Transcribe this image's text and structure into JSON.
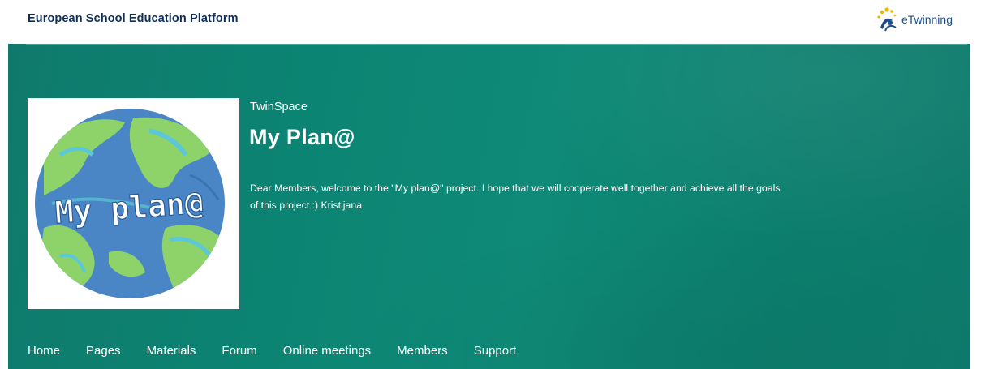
{
  "header": {
    "platform_title": "European School Education Platform",
    "logo_text": "eTwinning"
  },
  "hero": {
    "section_label": "TwinSpace",
    "title": "My Plan@",
    "description": "Dear Members, welcome to the \"My plan@\" project. I hope that we will cooperate well together and achieve all the goals of this project :) Kristijana",
    "image_text": "My plan@"
  },
  "nav": {
    "items": [
      {
        "label": "Home"
      },
      {
        "label": "Pages"
      },
      {
        "label": "Materials"
      },
      {
        "label": "Forum"
      },
      {
        "label": "Online meetings"
      },
      {
        "label": "Members"
      },
      {
        "label": "Support"
      }
    ]
  },
  "colors": {
    "brand_navy": "#0d2f57",
    "hero_teal": "#0c8473",
    "earth_blue": "#4a86c5",
    "earth_green": "#8dd36a"
  },
  "icons": {
    "logo": "etwinning-logo-icon"
  }
}
